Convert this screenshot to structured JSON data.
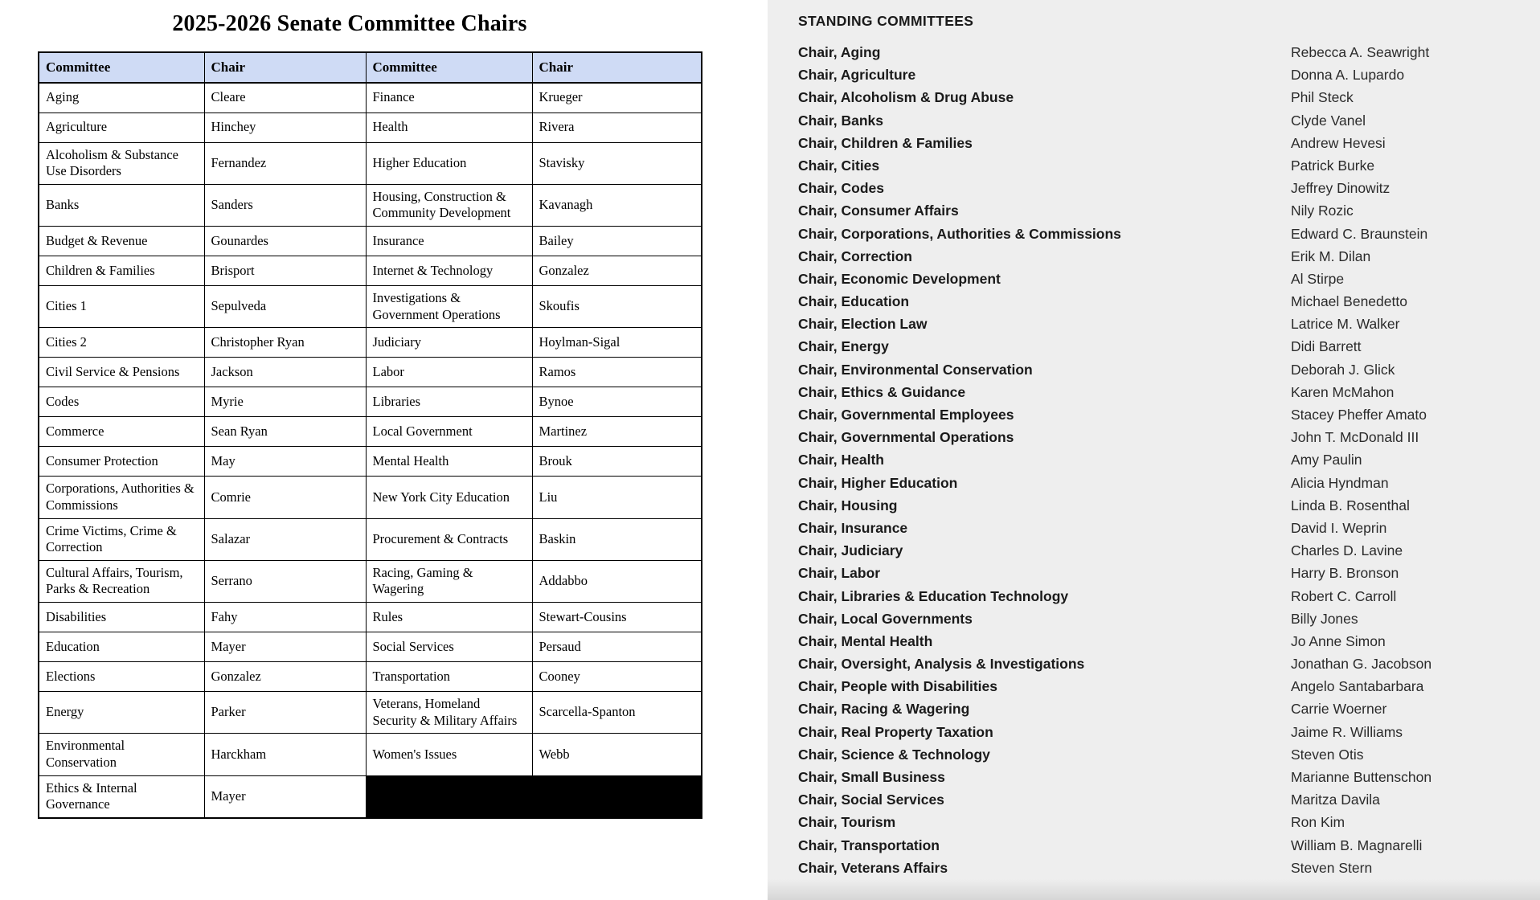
{
  "left_panel": {
    "title": "2025-2026 Senate Committee Chairs",
    "table": {
      "headers": [
        "Committee",
        "Chair",
        "Committee",
        "Chair"
      ],
      "rows": [
        [
          "Aging",
          "Cleare",
          "Finance",
          "Krueger"
        ],
        [
          "Agriculture",
          "Hinchey",
          "Health",
          "Rivera"
        ],
        [
          "Alcoholism & Substance Use Disorders",
          "Fernandez",
          "Higher Education",
          "Stavisky"
        ],
        [
          "Banks",
          "Sanders",
          "Housing, Construction & Community Development",
          "Kavanagh"
        ],
        [
          "Budget & Revenue",
          "Gounardes",
          "Insurance",
          "Bailey"
        ],
        [
          "Children & Families",
          "Brisport",
          "Internet & Technology",
          "Gonzalez"
        ],
        [
          "Cities 1",
          "Sepulveda",
          "Investigations & Government Operations",
          "Skoufis"
        ],
        [
          "Cities 2",
          "Christopher Ryan",
          "Judiciary",
          "Hoylman-Sigal"
        ],
        [
          "Civil Service & Pensions",
          "Jackson",
          "Labor",
          "Ramos"
        ],
        [
          "Codes",
          "Myrie",
          "Libraries",
          "Bynoe"
        ],
        [
          "Commerce",
          "Sean Ryan",
          "Local Government",
          "Martinez"
        ],
        [
          "Consumer Protection",
          "May",
          "Mental Health",
          "Brouk"
        ],
        [
          "Corporations, Authorities & Commissions",
          "Comrie",
          "New York City Education",
          "Liu"
        ],
        [
          "Crime Victims, Crime & Correction",
          "Salazar",
          "Procurement & Contracts",
          "Baskin"
        ],
        [
          "Cultural Affairs, Tourism, Parks & Recreation",
          "Serrano",
          "Racing, Gaming & Wagering",
          "Addabbo"
        ],
        [
          "Disabilities",
          "Fahy",
          "Rules",
          "Stewart-Cousins"
        ],
        [
          "Education",
          "Mayer",
          "Social Services",
          "Persaud"
        ],
        [
          "Elections",
          "Gonzalez",
          "Transportation",
          "Cooney"
        ],
        [
          "Energy",
          "Parker",
          "Veterans, Homeland Security & Military Affairs",
          "Scarcella-Spanton"
        ],
        [
          "Environmental Conservation",
          "Harckham",
          "Women's Issues",
          "Webb"
        ],
        [
          "Ethics & Internal Governance",
          "Mayer",
          "",
          ""
        ]
      ],
      "blacked_out_cells": [
        [
          20,
          2
        ],
        [
          20,
          3
        ]
      ],
      "header_background": "#cfdbf5",
      "border_color": "#000000"
    }
  },
  "right_panel": {
    "heading": "STANDING COMMITTEES",
    "background": "#eeeeee",
    "entries": [
      {
        "role": "Chair, Aging",
        "member": "Rebecca A. Seawright"
      },
      {
        "role": "Chair, Agriculture",
        "member": "Donna A. Lupardo"
      },
      {
        "role": "Chair, Alcoholism & Drug Abuse",
        "member": "Phil Steck"
      },
      {
        "role": "Chair, Banks",
        "member": "Clyde Vanel"
      },
      {
        "role": "Chair, Children & Families",
        "member": "Andrew Hevesi"
      },
      {
        "role": "Chair, Cities",
        "member": "Patrick Burke"
      },
      {
        "role": "Chair, Codes",
        "member": "Jeffrey Dinowitz"
      },
      {
        "role": "Chair, Consumer Affairs",
        "member": "Nily Rozic"
      },
      {
        "role": "Chair, Corporations, Authorities & Commissions",
        "member": "Edward C. Braunstein"
      },
      {
        "role": "Chair, Correction",
        "member": "Erik M. Dilan"
      },
      {
        "role": "Chair, Economic Development",
        "member": "Al Stirpe"
      },
      {
        "role": "Chair, Education",
        "member": "Michael Benedetto"
      },
      {
        "role": "Chair, Election Law",
        "member": "Latrice M. Walker"
      },
      {
        "role": "Chair, Energy",
        "member": "Didi Barrett"
      },
      {
        "role": "Chair, Environmental Conservation",
        "member": "Deborah J. Glick"
      },
      {
        "role": "Chair, Ethics & Guidance",
        "member": "Karen McMahon"
      },
      {
        "role": "Chair, Governmental Employees",
        "member": "Stacey Pheffer Amato"
      },
      {
        "role": "Chair, Governmental Operations",
        "member": "John T. McDonald III"
      },
      {
        "role": "Chair, Health",
        "member": "Amy Paulin"
      },
      {
        "role": "Chair, Higher Education",
        "member": "Alicia Hyndman"
      },
      {
        "role": "Chair, Housing",
        "member": "Linda B. Rosenthal"
      },
      {
        "role": "Chair, Insurance",
        "member": "David I. Weprin"
      },
      {
        "role": "Chair, Judiciary",
        "member": "Charles D. Lavine"
      },
      {
        "role": "Chair, Labor",
        "member": "Harry B. Bronson"
      },
      {
        "role": "Chair, Libraries & Education Technology",
        "member": "Robert C. Carroll"
      },
      {
        "role": "Chair, Local Governments",
        "member": "Billy Jones"
      },
      {
        "role": "Chair, Mental Health",
        "member": "Jo Anne Simon"
      },
      {
        "role": "Chair, Oversight, Analysis & Investigations",
        "member": "Jonathan G. Jacobson"
      },
      {
        "role": "Chair, People with Disabilities",
        "member": "Angelo Santabarbara"
      },
      {
        "role": "Chair, Racing & Wagering",
        "member": "Carrie Woerner"
      },
      {
        "role": "Chair, Real Property Taxation",
        "member": "Jaime R. Williams"
      },
      {
        "role": "Chair, Science & Technology",
        "member": "Steven Otis"
      },
      {
        "role": "Chair, Small Business",
        "member": "Marianne Buttenschon"
      },
      {
        "role": "Chair, Social Services",
        "member": "Maritza Davila"
      },
      {
        "role": "Chair, Tourism",
        "member": "Ron Kim"
      },
      {
        "role": "Chair, Transportation",
        "member": "William B. Magnarelli"
      },
      {
        "role": "Chair, Veterans Affairs",
        "member": "Steven Stern"
      }
    ]
  }
}
